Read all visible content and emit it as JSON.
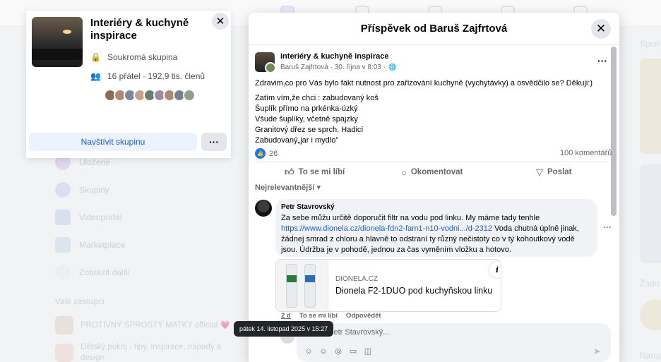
{
  "background": {
    "nav": [
      {
        "label": "Uložené"
      },
      {
        "label": "Skupiny"
      },
      {
        "label": "Videoportál"
      },
      {
        "label": "Marketplace"
      },
      {
        "label": "Zobrazit další"
      }
    ],
    "shortcuts_title": "Vaši zástupci",
    "shortcuts": [
      {
        "label": "PROTIVNÝ SPROSTÝ MATKY official 💗"
      },
      {
        "label": "Dětský pokoj - tipy, inspirace, nápady a design"
      }
    ],
    "right_titles": [
      "Spon",
      "Žádo",
      "Naroz"
    ]
  },
  "group_card": {
    "title": "Interiéry & kuchyně inspirace",
    "privacy": "Soukromá skupina",
    "members": "16 přátel · 192,9 tis. členů",
    "visit_label": "Navštívit skupinu",
    "more_label": "···",
    "close_label": "✕",
    "avatar_colors": [
      "#8b6b5a",
      "#b08a6e",
      "#7a8a9a",
      "#c4a38a",
      "#6a7f6a",
      "#9a8fa0",
      "#a88c74",
      "#7d7d8c",
      "#8fa08a"
    ]
  },
  "modal": {
    "title": "Příspěvek od Baruš Zajfrtová",
    "close_label": "✕",
    "post": {
      "group": "Interiéry & kuchyně inspirace",
      "author_time": "Baruš Zajfrtová · 30. října v 8:03 ·",
      "globe": "🌐",
      "dots": "···",
      "intro": "Zdravim,co pro Vás bylo fakt nutnost pro zařizování kuchyně (vychytávky) a osvědčilo se? Děkuji:)",
      "lines": [
        "Zatím vím,že chci : zabudovaný koš",
        "Šuplík přímo na prkénka-úzký",
        "Všude šuplíky, včetně spajzky",
        "Granitový dřez se sprch. Hadicí",
        "Zabudovaný„jar i mydlo\""
      ],
      "like_count": "26",
      "comment_count": "100 komentářů",
      "actions": {
        "like": "To se mi líbí",
        "comment": "Okomentovat",
        "share": "Poslat"
      },
      "sort_label": "Nejrelevantnější"
    },
    "comment": {
      "author": "Petr Stavrovský",
      "text_before": "Za sebe můžu určitě doporučit filtr na vodu pod linku. My máme tady tenhle ",
      "link": "https://www.dionela.cz/dionela-fdn2-fam1-n10-vodni.../d-2312",
      "text_after": " Voda chutná úplně jinak, žádnej smrad z chloru a hlavně to odstraní ty různý nečistoty co v tý kohoutkový vodě jsou. Údržba je v pohodě, jednou za čas vyměním vložku a hotovo.",
      "dots": "···",
      "link_card": {
        "domain": "DIONELA.CZ",
        "title": "Dionela F2-1DUO pod kuchyňskou linku",
        "info": "i"
      },
      "time": "2 d",
      "like": "To se mi líbí",
      "reply": "Odpovědět",
      "tooltip": "pátek 14. listopad 2025 v 15:27"
    },
    "reply_box": {
      "placeholder": "Odpovědět uživateli Petr Stavrovský...",
      "visible_text": "e Petr Stavrovský..."
    }
  }
}
